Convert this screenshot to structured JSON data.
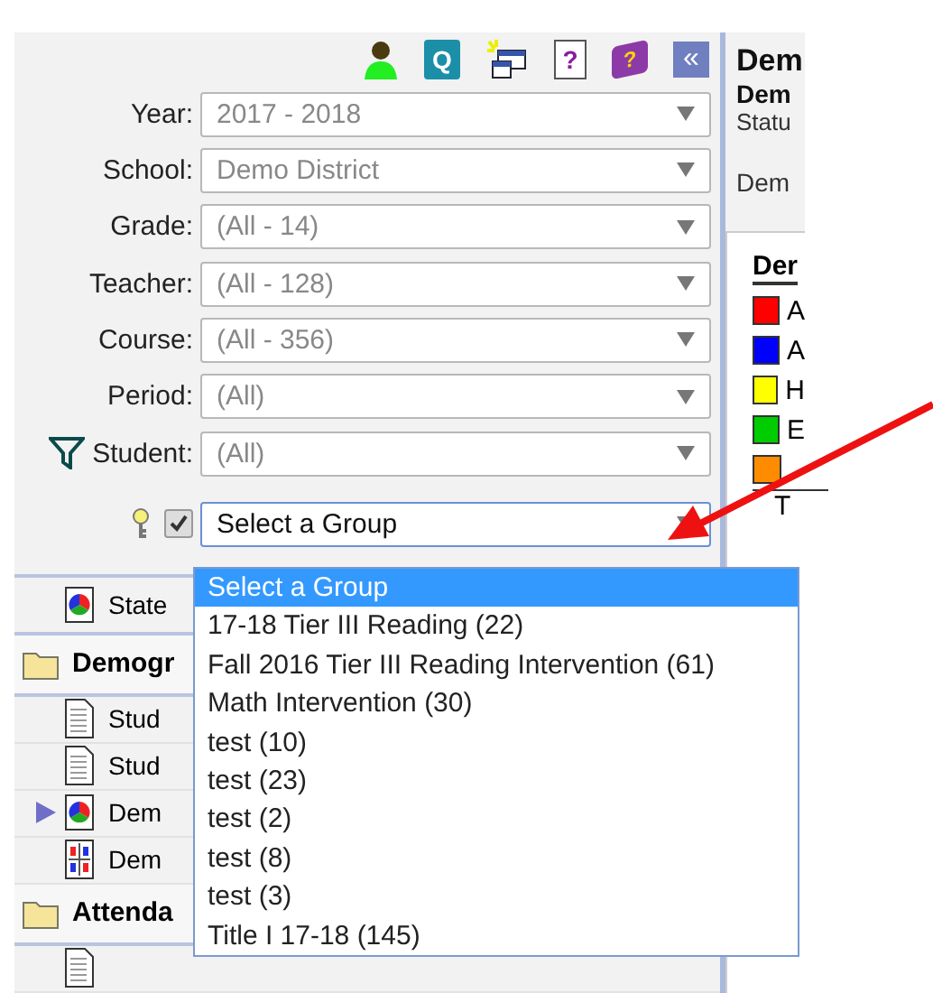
{
  "toolbar": [
    {
      "kind": "person"
    },
    {
      "kind": "quick",
      "glyph": "Q"
    },
    {
      "kind": "window"
    },
    {
      "kind": "help",
      "glyph": "?"
    },
    {
      "kind": "book",
      "glyph": "?"
    },
    {
      "kind": "collapse",
      "glyph": "«"
    }
  ],
  "filters": [
    {
      "label": "Year:",
      "value": "2017 - 2018",
      "kind": "plain"
    },
    {
      "label": "School:",
      "value": "Demo District",
      "kind": "plain"
    },
    {
      "label": "Grade:",
      "value": "(All - 14)",
      "kind": "plain"
    },
    {
      "label": "Teacher:",
      "value": "(All - 128)",
      "kind": "plain"
    },
    {
      "label": "Course:",
      "value": "(All - 356)",
      "kind": "plain"
    },
    {
      "label": "Period:",
      "value": "(All)",
      "kind": "plain"
    },
    {
      "label": "Student:",
      "value": "(All)",
      "kind": "filter"
    }
  ],
  "group": {
    "checked": true,
    "value": "Select a Group",
    "options": [
      {
        "label": "Select a Group",
        "selected": true
      },
      {
        "label": "17-18 Tier III Reading (22)",
        "selected": false
      },
      {
        "label": "Fall 2016 Tier III Reading Intervention (61)",
        "selected": false
      },
      {
        "label": "Math Intervention (30)",
        "selected": false
      },
      {
        "label": "test (10)",
        "selected": false
      },
      {
        "label": "test (23)",
        "selected": false
      },
      {
        "label": "test (2)",
        "selected": false
      },
      {
        "label": "test (8)",
        "selected": false
      },
      {
        "label": "test (3)",
        "selected": false
      },
      {
        "label": "Title I 17-18 (145)",
        "selected": false
      }
    ]
  },
  "nav": [
    {
      "kind": "chart",
      "label": "State",
      "current": false
    },
    {
      "kind": "section",
      "label": "Demogr"
    },
    {
      "kind": "document",
      "label": "Stud",
      "current": false
    },
    {
      "kind": "document",
      "label": "Stud",
      "current": false
    },
    {
      "kind": "chart",
      "label": "Dem",
      "current": true
    },
    {
      "kind": "grid",
      "label": "Dem",
      "current": false
    },
    {
      "kind": "section",
      "label": "Attenda"
    },
    {
      "kind": "document",
      "current": false
    }
  ],
  "report": {
    "title": "Dem",
    "subtitle": "Dem",
    "status": "Statu",
    "tab": "Dem",
    "legend_title": "Der",
    "legend": [
      {
        "label": "A",
        "color": "#ff0000"
      },
      {
        "label": "A",
        "color": "#0000ff"
      },
      {
        "label": "H",
        "color": "#ffff00"
      },
      {
        "label": "E",
        "color": "#00cc00"
      },
      {
        "color": "#ff8c00"
      }
    ],
    "total": "T"
  }
}
